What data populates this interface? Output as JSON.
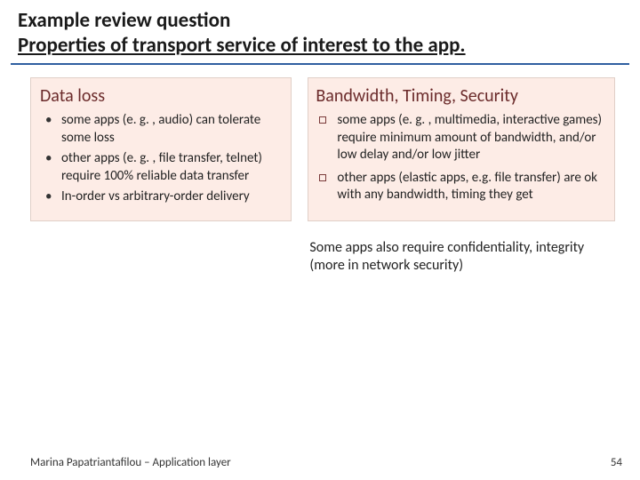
{
  "title": {
    "line1": "Example review question",
    "line2": "Properties of transport service of interest to the app."
  },
  "left": {
    "heading": "Data loss",
    "bullets": [
      "some apps (e. g. , audio) can tolerate some loss",
      "other apps (e. g. , file transfer, telnet) require 100% reliable data transfer",
      "In-order vs arbitrary-order delivery"
    ]
  },
  "right": {
    "heading": "Bandwidth, Timing, Security",
    "bullets": [
      "some apps (e. g. , multimedia, interactive games) require minimum amount of bandwidth, and/or low delay and/or low jitter",
      "other apps (elastic apps, e.g. file transfer) are ok with any bandwidth, timing they get"
    ],
    "note": "Some apps also require confidentiality, integrity (more in network security)"
  },
  "footer": {
    "author": "Marina Papatriantafilou – Application layer",
    "page": "54"
  }
}
